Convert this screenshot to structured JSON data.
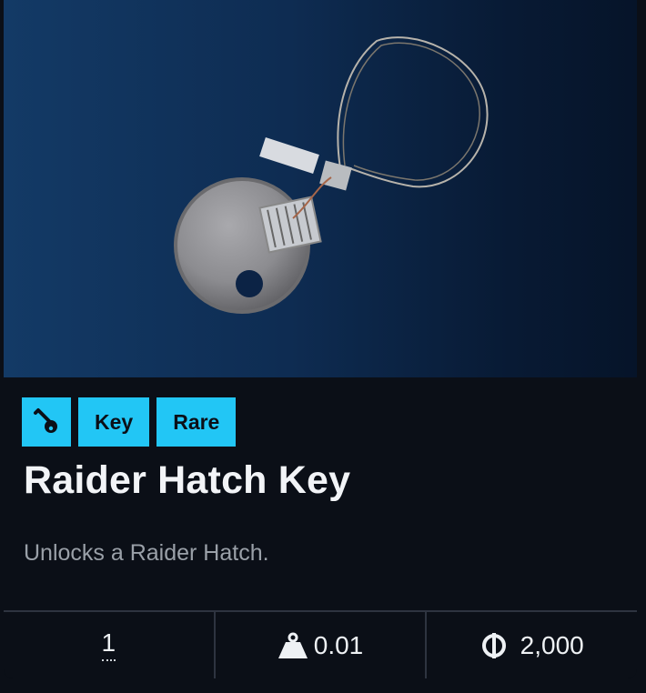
{
  "item": {
    "name": "Raider Hatch Key",
    "description": "Unlocks a Raider Hatch.",
    "tags": [
      {
        "icon": "key-icon"
      },
      {
        "label": "Key"
      },
      {
        "label": "Rare"
      }
    ]
  },
  "stats": {
    "quantity": "1",
    "weight": "0.01",
    "weight_icon": "weight-icon",
    "price": "2,000",
    "price_icon": "coin-icon"
  },
  "colors": {
    "badge": "#22c6f5",
    "background": "#0b0f17",
    "hero_gradient": [
      "#133a66",
      "#061429"
    ]
  }
}
